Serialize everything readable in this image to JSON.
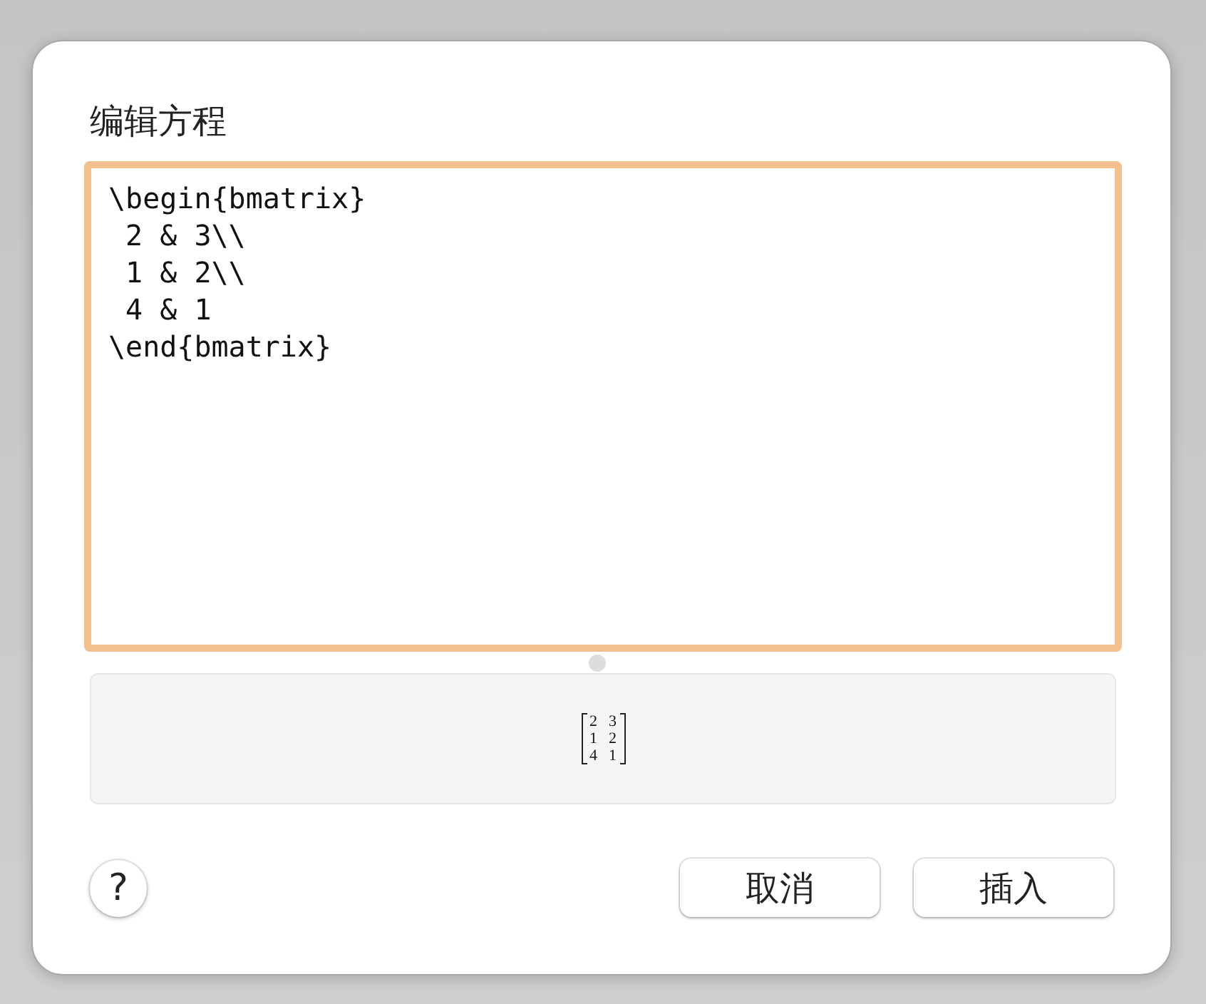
{
  "dialog": {
    "title": "编辑方程"
  },
  "editor": {
    "value": "\\begin{bmatrix}\n 2 & 3\\\\\n 1 & 2\\\\\n 4 & 1\n\\end{bmatrix}",
    "focused": true
  },
  "preview": {
    "matrix": [
      [
        "2",
        "3"
      ],
      [
        "1",
        "2"
      ],
      [
        "4",
        "1"
      ]
    ]
  },
  "help_button": "?",
  "buttons": [
    "取消",
    "插入"
  ]
}
